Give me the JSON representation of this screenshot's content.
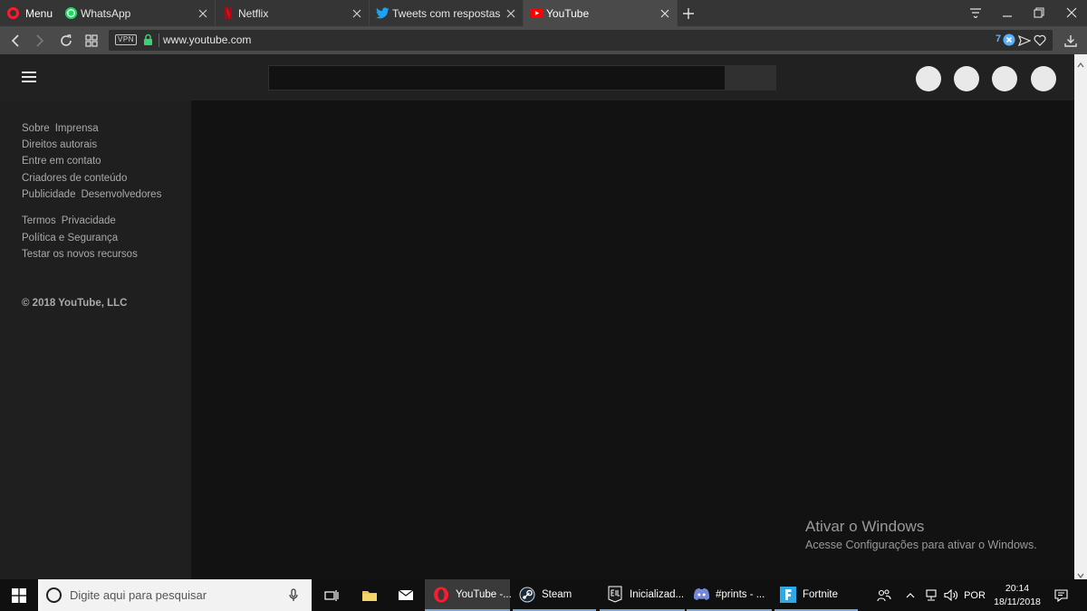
{
  "browser": {
    "menu_label": "Menu",
    "tabs": [
      {
        "label": "WhatsApp"
      },
      {
        "label": "Netflix"
      },
      {
        "label": "Tweets com respostas de"
      },
      {
        "label": "YouTube"
      }
    ],
    "url": "www.youtube.com",
    "vpn_label": "VPN",
    "adblock_count": "7"
  },
  "sidebar": {
    "footer_lines": [
      [
        "Sobre",
        "Imprensa"
      ],
      [
        "Direitos autorais"
      ],
      [
        "Entre em contato"
      ],
      [
        "Criadores de conteúdo"
      ],
      [
        "Publicidade",
        "Desenvolvedores"
      ],
      [
        "Termos",
        "Privacidade"
      ],
      [
        "Política e Segurança"
      ],
      [
        "Testar os novos recursos"
      ]
    ],
    "copyright": "© 2018 YouTube, LLC"
  },
  "watermark": {
    "title": "Ativar o Windows",
    "subtitle": "Acesse Configurações para ativar o Windows."
  },
  "taskbar": {
    "search_placeholder": "Digite aqui para pesquisar",
    "apps": [
      {
        "label": "YouTube -..."
      },
      {
        "label": "Steam"
      },
      {
        "label": "Inicializad..."
      },
      {
        "label": "#prints - ..."
      },
      {
        "label": "Fortnite"
      }
    ],
    "language": "POR",
    "time": "20:14",
    "date": "18/11/2018"
  },
  "colors": {
    "opera_red": "#ff1b2d",
    "whatsapp_green": "#25d366",
    "netflix_red": "#e50914",
    "twitter_blue": "#1da1f2",
    "youtube_red": "#ff0000",
    "vpn_green": "#3cd070",
    "taskbar_accent": "#7aa7d8"
  },
  "icons": {
    "tab_favicons": [
      "whatsapp-icon",
      "netflix-icon",
      "twitter-icon",
      "youtube-icon"
    ],
    "taskbar_apps": [
      "opera-icon",
      "steam-icon",
      "epic-games-icon",
      "discord-icon",
      "fortnite-icon"
    ]
  }
}
